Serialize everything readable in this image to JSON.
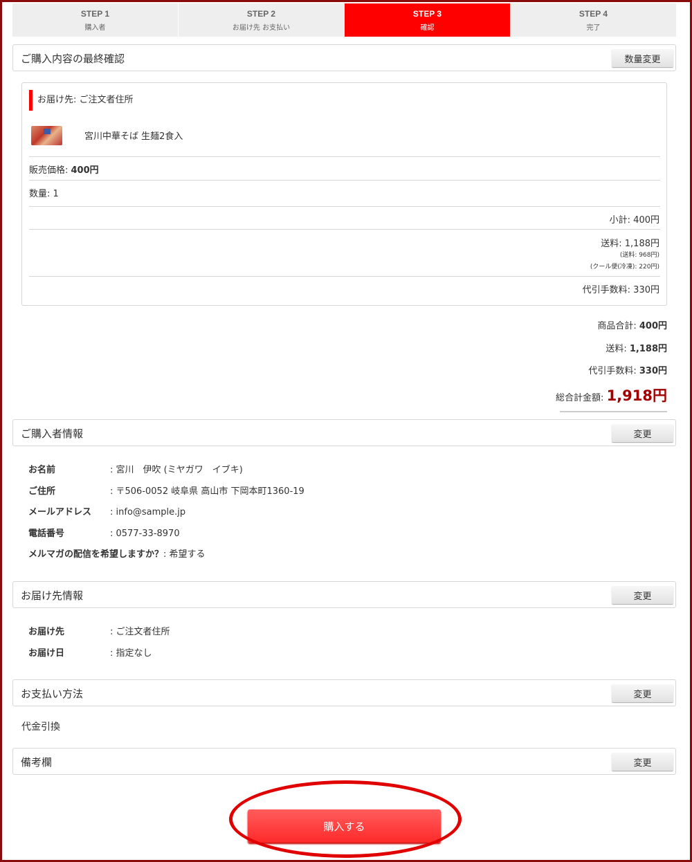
{
  "steps": [
    {
      "num": "STEP 1",
      "label": "購入者"
    },
    {
      "num": "STEP 2",
      "label": "お届け先 お支払い"
    },
    {
      "num": "STEP 3",
      "label": "確認"
    },
    {
      "num": "STEP 4",
      "label": "完了"
    }
  ],
  "confirm": {
    "title": "ご購入内容の最終確認",
    "change_qty": "数量変更",
    "destination": "お届け先: ご注文者住所",
    "product": "宮川中華そば 生麺2食入",
    "price_label": "販売価格: ",
    "price": "400円",
    "qty": "数量: 1",
    "subtotal": "小計: 400円",
    "shipping": "送料: 1,188円",
    "shipping_detail1": "(送料: 968円)",
    "shipping_detail2": "(クール便(冷凍): 220円)",
    "cod_fee": "代引手数料: 330円"
  },
  "totals": {
    "goods_label": "商品合計: ",
    "goods": "400円",
    "shipping_label": "送料: ",
    "shipping": "1,188円",
    "cod_label": "代引手数料: ",
    "cod": "330円",
    "grand_label": "総合計金額: ",
    "grand": "1,918円"
  },
  "buyer": {
    "title": "ご購入者情報",
    "change": "変更",
    "name_k": "お名前",
    "name_v": ": 宮川　伊吹 (ミヤガワ　イブキ)",
    "addr_k": "ご住所",
    "addr_v": ": 〒506-0052 岐阜県 高山市 下岡本町1360-19",
    "mail_k": "メールアドレス",
    "mail_v": ": info@sample.jp",
    "tel_k": "電話番号",
    "tel_v": ": 0577-33-8970",
    "mm_k": "メルマガの配信を希望しますか？",
    "mm_v": ": 希望する"
  },
  "delivery": {
    "title": "お届け先情報",
    "change": "変更",
    "to_k": "お届け先",
    "to_v": ": ご注文者住所",
    "date_k": "お届け日",
    "date_v": ": 指定なし"
  },
  "payment": {
    "title": "お支払い方法",
    "change": "変更",
    "method": "代金引換"
  },
  "remarks": {
    "title": "備考欄",
    "change": "変更"
  },
  "purchase_button": "購入する"
}
